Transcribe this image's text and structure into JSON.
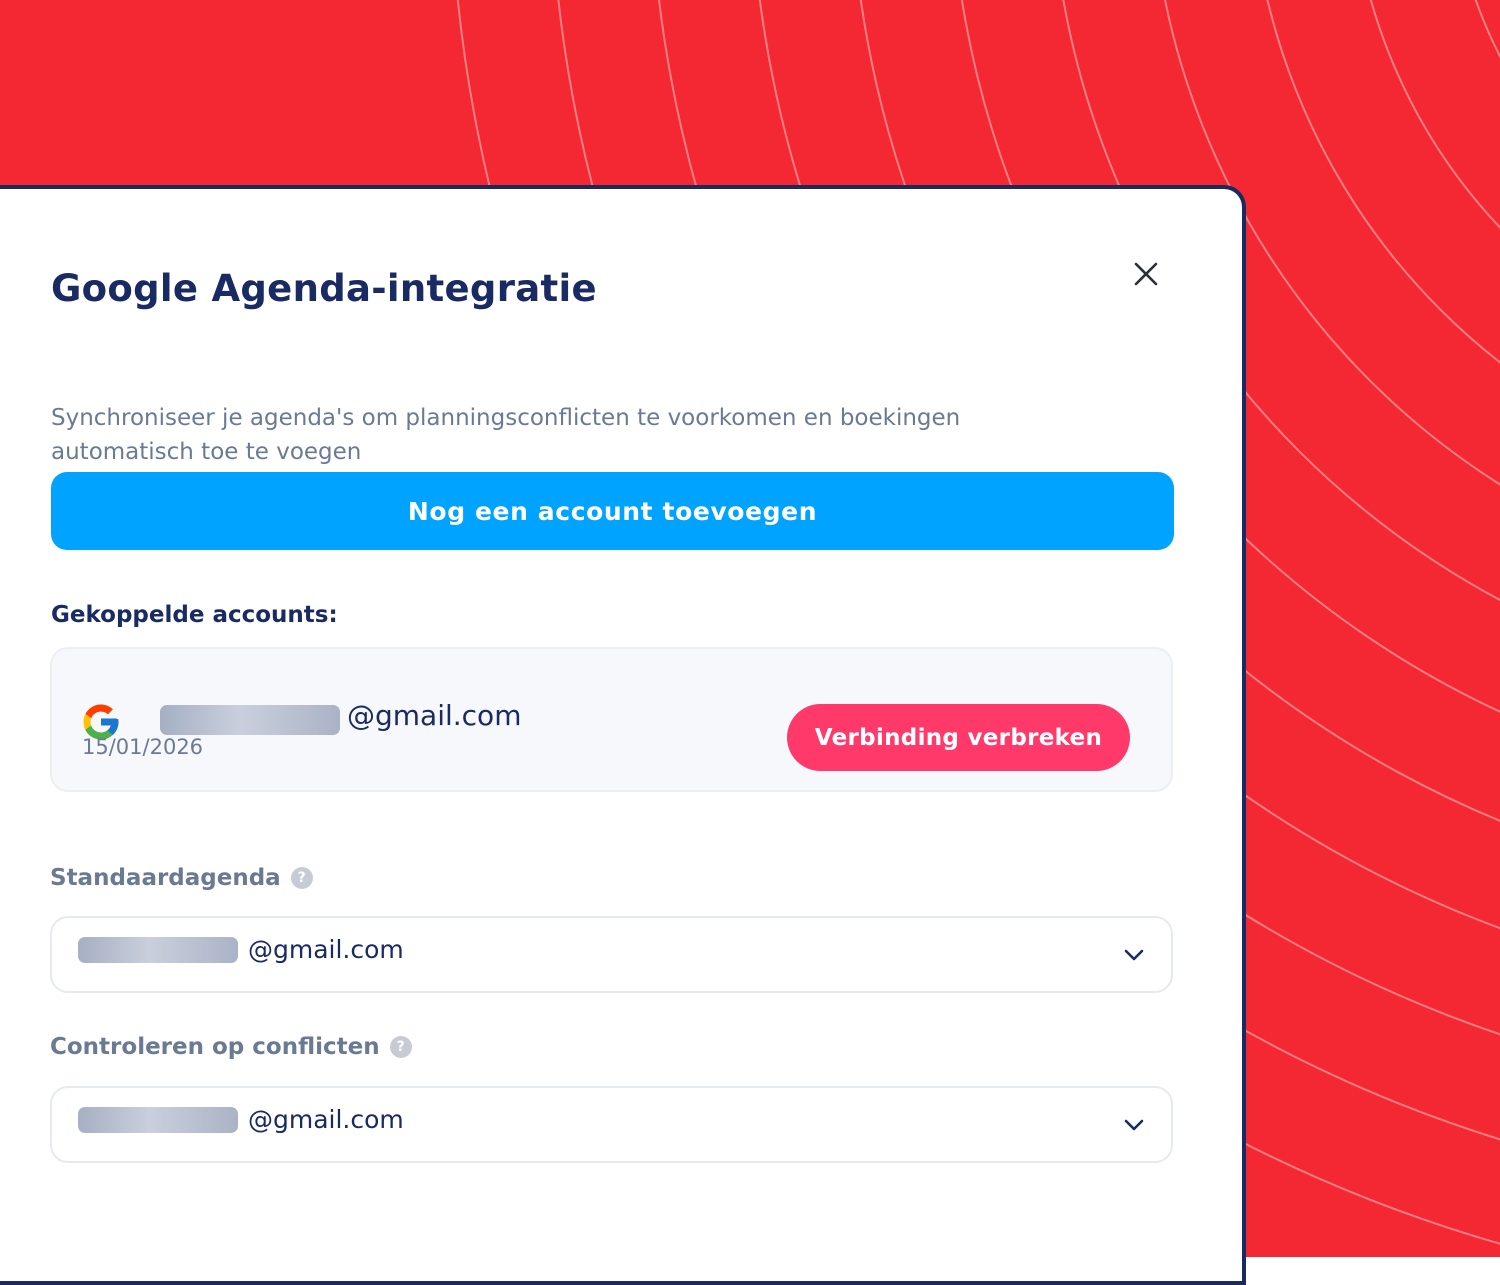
{
  "modal": {
    "title": "Google Agenda-integratie",
    "description": "Synchroniseer je agenda's om planningsconflicten te voorkomen en boekingen automatisch toe te voegen",
    "add_account_label": "Nog een account toevoegen",
    "linked_accounts_label": "Gekoppelde accounts:"
  },
  "account": {
    "email_suffix": "@gmail.com",
    "date": "15/01/2026",
    "disconnect_label": "Verbinding verbreken"
  },
  "default_calendar": {
    "label": "Standaardagenda",
    "value_suffix": "@gmail.com"
  },
  "conflict_check": {
    "label": "Controleren op conflicten",
    "value_suffix": "@gmail.com"
  },
  "icons": {
    "close": "close-icon",
    "google": "google-logo-icon",
    "help": "help-icon",
    "chevron": "chevron-down-icon",
    "help_glyph": "?"
  },
  "colors": {
    "background": "#f42832",
    "primary_button": "#00a3ff",
    "danger_button": "#ff3a6b",
    "heading": "#1a2b63",
    "muted_text": "#6b7a93"
  }
}
